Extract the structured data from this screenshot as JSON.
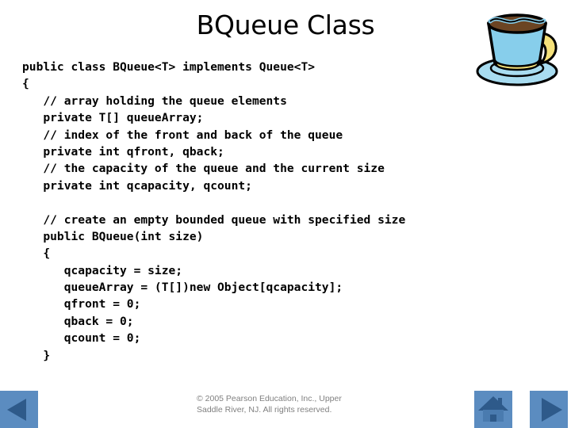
{
  "slide": {
    "title": "BQueue Class",
    "background_color": "#ffffff"
  },
  "artwork": {
    "coffee_cup": {
      "name": "coffee-cup-image",
      "cup_color": "#87CEEB",
      "coffee_color": "#6B4423",
      "handle_color": "#F5E17A",
      "outline_color": "#000000",
      "saucer_color": "#A8DCF0"
    }
  },
  "code": {
    "language": "java",
    "lines": [
      "public class BQueue<T> implements Queue<T>",
      "{",
      "   // array holding the queue elements",
      "   private T[] queueArray;",
      "   // index of the front and back of the queue",
      "   private int qfront, qback;",
      "   // the capacity of the queue and the current size",
      "   private int qcapacity, qcount;",
      "",
      "   // create an empty bounded queue with specified size",
      "   public BQueue(int size)",
      "   {",
      "      qcapacity = size;",
      "      queueArray = (T[])new Object[qcapacity];",
      "      qfront = 0;",
      "      qback = 0;",
      "      qcount = 0;",
      "   }"
    ]
  },
  "footer": {
    "copyright_line_1": "© 2005 Pearson Education, Inc., Upper",
    "copyright_line_2": "Saddle River, NJ.  All rights reserved.",
    "text_color": "#808080"
  },
  "navigation": {
    "button_color": "#5B8CC0",
    "glyph_color": "#2E5A8A",
    "back": {
      "label": "Previous slide",
      "icon": "triangle-left-icon"
    },
    "home": {
      "label": "Home",
      "icon": "home-icon"
    },
    "forward": {
      "label": "Next slide",
      "icon": "triangle-right-icon"
    }
  }
}
